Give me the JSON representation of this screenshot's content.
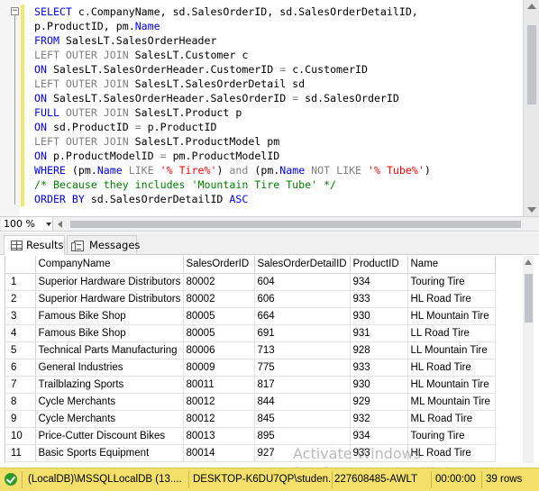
{
  "editor": {
    "collapse_glyph": "−",
    "lines": [
      [
        {
          "t": "SELECT",
          "c": "kw"
        },
        {
          "t": " c.CompanyName, sd.SalesOrderID, sd.SalesOrderDetailID,",
          "c": ""
        }
      ],
      [
        {
          "t": "p.ProductID, pm.",
          "c": ""
        },
        {
          "t": "Name",
          "c": "kw"
        }
      ],
      [
        {
          "t": "FROM",
          "c": "kw"
        },
        {
          "t": " SalesLT.SalesOrderHeader",
          "c": ""
        }
      ],
      [
        {
          "t": "LEFT OUTER JOIN",
          "c": "gr"
        },
        {
          "t": " SalesLT.Customer c",
          "c": ""
        }
      ],
      [
        {
          "t": "ON",
          "c": "kw"
        },
        {
          "t": " SalesLT.SalesOrderHeader.CustomerID ",
          "c": ""
        },
        {
          "t": "=",
          "c": "gr"
        },
        {
          "t": " c.CustomerID",
          "c": ""
        }
      ],
      [
        {
          "t": "LEFT OUTER JOIN",
          "c": "gr"
        },
        {
          "t": " SalesLT.SalesOrderDetail sd",
          "c": ""
        }
      ],
      [
        {
          "t": "ON",
          "c": "kw"
        },
        {
          "t": " SalesLT.SalesOrderHeader.SalesOrderID ",
          "c": ""
        },
        {
          "t": "=",
          "c": "gr"
        },
        {
          "t": " sd.SalesOrderID",
          "c": ""
        }
      ],
      [
        {
          "t": "FULL",
          "c": "kw"
        },
        {
          "t": " OUTER JOIN",
          "c": "gr"
        },
        {
          "t": " SalesLT.Product p",
          "c": ""
        }
      ],
      [
        {
          "t": "ON",
          "c": "kw"
        },
        {
          "t": " sd.ProductID ",
          "c": ""
        },
        {
          "t": "=",
          "c": "gr"
        },
        {
          "t": " p.ProductID",
          "c": ""
        }
      ],
      [
        {
          "t": "LEFT OUTER JOIN",
          "c": "gr"
        },
        {
          "t": " SalesLT.ProductModel pm",
          "c": ""
        }
      ],
      [
        {
          "t": "ON",
          "c": "kw"
        },
        {
          "t": " p.ProductModelID ",
          "c": ""
        },
        {
          "t": "=",
          "c": "gr"
        },
        {
          "t": " pm.ProductModelID",
          "c": ""
        }
      ],
      [
        {
          "t": "WHERE",
          "c": "kw"
        },
        {
          "t": " (pm.",
          "c": ""
        },
        {
          "t": "Name",
          "c": "kw"
        },
        {
          "t": " LIKE ",
          "c": "gr"
        },
        {
          "t": "'% Tire%'",
          "c": "str"
        },
        {
          "t": ") ",
          "c": ""
        },
        {
          "t": "and",
          "c": "gr"
        },
        {
          "t": " (pm.",
          "c": ""
        },
        {
          "t": "Name",
          "c": "kw"
        },
        {
          "t": " NOT LIKE ",
          "c": "gr"
        },
        {
          "t": "'% Tube%'",
          "c": "str"
        },
        {
          "t": ")",
          "c": ""
        }
      ],
      [
        {
          "t": "/* Because they includes 'Mountain Tire Tube' */",
          "c": "cm"
        }
      ],
      [
        {
          "t": "ORDER BY",
          "c": "kw"
        },
        {
          "t": " sd.SalesOrderDetailID ",
          "c": ""
        },
        {
          "t": "ASC",
          "c": "kw"
        }
      ]
    ]
  },
  "zoom": {
    "value": "100 %"
  },
  "tabs": [
    {
      "label": "Results",
      "active": true
    },
    {
      "label": "Messages",
      "active": false
    }
  ],
  "grid": {
    "columns": [
      "",
      "CompanyName",
      "SalesOrderID",
      "SalesOrderDetailID",
      "ProductID",
      "Name"
    ],
    "rows": [
      [
        "1",
        "Superior Hardware Distributors",
        "80002",
        "604",
        "934",
        "Touring Tire"
      ],
      [
        "2",
        "Superior Hardware Distributors",
        "80002",
        "606",
        "933",
        "HL Road Tire"
      ],
      [
        "3",
        "Famous Bike Shop",
        "80005",
        "664",
        "930",
        "HL Mountain Tire"
      ],
      [
        "4",
        "Famous Bike Shop",
        "80005",
        "691",
        "931",
        "LL Road Tire"
      ],
      [
        "5",
        "Technical Parts Manufacturing",
        "80006",
        "713",
        "928",
        "LL Mountain Tire"
      ],
      [
        "6",
        "General Industries",
        "80009",
        "775",
        "933",
        "HL Road Tire"
      ],
      [
        "7",
        "Trailblazing Sports",
        "80011",
        "817",
        "930",
        "HL Mountain Tire"
      ],
      [
        "8",
        "Cycle Merchants",
        "80012",
        "844",
        "929",
        "ML Mountain Tire"
      ],
      [
        "9",
        "Cycle Merchants",
        "80012",
        "845",
        "932",
        "ML Road Tire"
      ],
      [
        "10",
        "Price-Cutter Discount Bikes",
        "80013",
        "895",
        "934",
        "Touring Tire"
      ],
      [
        "11",
        "Basic Sports Equipment",
        "80014",
        "927",
        "933",
        "HL Road Tire"
      ]
    ]
  },
  "watermark": {
    "title": "Activate Windows",
    "subtitle": "Go to Settings to activate Windows."
  },
  "status": {
    "server": "(LocalDB)\\MSSQLLocalDB (13....",
    "user": "DESKTOP-K6DU7QP\\studen...",
    "database": "227608485-AWLT",
    "elapsed": "00:00:00",
    "rows": "39 rows"
  },
  "colors": {
    "keyword": "#0000ff",
    "operator": "#808080",
    "string": "#ff0000",
    "comment": "#008000",
    "status_bar": "#f2e06a"
  }
}
